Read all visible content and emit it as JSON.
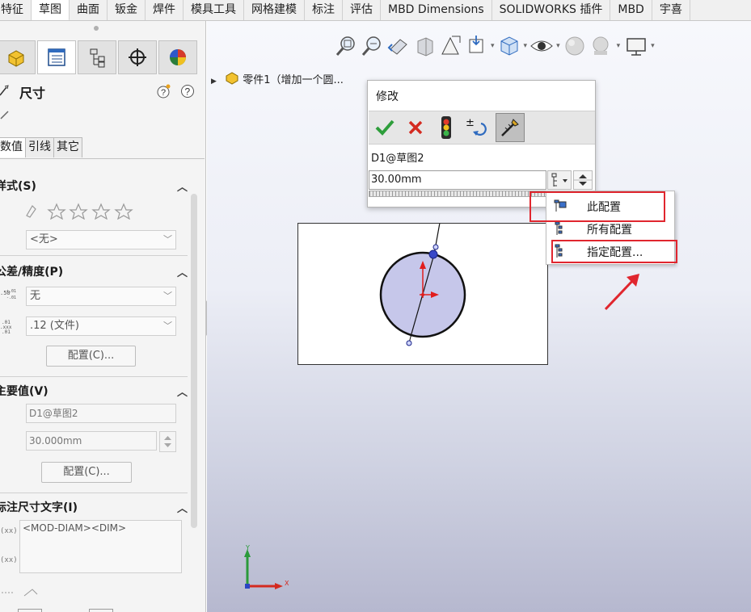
{
  "ribbon": {
    "tabs": [
      "特征",
      "草图",
      "曲面",
      "钣金",
      "焊件",
      "模具工具",
      "网格建模",
      "标注",
      "评估",
      "MBD Dimensions",
      "SOLIDWORKS 插件",
      "MBD",
      "宇喜"
    ],
    "active_index": 1
  },
  "property_manager": {
    "title": "尺寸",
    "tabs": [
      "数值",
      "引线",
      "其它"
    ],
    "style": {
      "header": "样式(S)",
      "combo_value": "<无>"
    },
    "tolerance": {
      "header": "公差/精度(P)",
      "tol_value": "无",
      "precision_value": ".12 (文件)",
      "config_button": "配置(C)..."
    },
    "primary": {
      "header": "主要值(V)",
      "name_value": "D1@草图2",
      "dim_value": "30.000mm",
      "config_button": "配置(C)..."
    },
    "dim_text": {
      "header": "标注尺寸文字(I)",
      "text": "<MOD-DIAM><DIM>"
    }
  },
  "viewport": {
    "tree_node": "零件1（增加一个圆...",
    "triad": {
      "y": "Y",
      "x": "X"
    }
  },
  "modify_dialog": {
    "title": "修改",
    "dim_name": "D1@草图2",
    "value": "30.00mm"
  },
  "config_menu": {
    "items": [
      "此配置",
      "所有配置",
      "指定配置..."
    ]
  },
  "colors": {
    "highlight": "#e0262e",
    "ok": "#2e9e3b",
    "cancel": "#d42a20",
    "sketch_fill": "#c6c7ea"
  }
}
